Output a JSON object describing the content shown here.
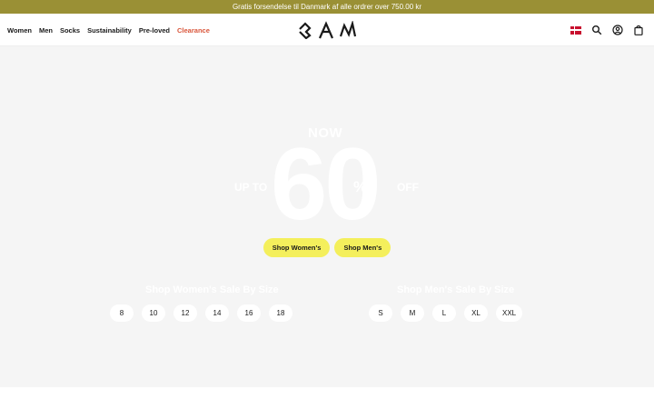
{
  "announcement": "Gratis forsendelse til Danmark af alle ordrer over 750.00 kr",
  "nav": {
    "links": [
      "Women",
      "Men",
      "Socks",
      "Sustainability",
      "Pre-loved",
      "Clearance"
    ],
    "icons": [
      "denmark-flag",
      "search-icon",
      "account-icon",
      "bag-icon"
    ]
  },
  "hero": {
    "now": "NOW",
    "up_to": "UP TO",
    "number": "60",
    "percent": "%",
    "off": "OFF",
    "buttons": [
      "Shop Women's",
      "Shop Men's"
    ],
    "women_sizes_title": "Shop Women's Sale By Size",
    "women_sizes": [
      "8",
      "10",
      "12",
      "14",
      "16",
      "18"
    ],
    "men_sizes_title": "Shop Men's Sale By Size",
    "men_sizes": [
      "S",
      "M",
      "L",
      "XL",
      "XXL"
    ]
  },
  "colors": {
    "announcement_bg": "#9a9035",
    "clearance": "#d9553a",
    "cta_yellow": "#f4ef5c",
    "hero_bg": "#f5f5f5"
  }
}
